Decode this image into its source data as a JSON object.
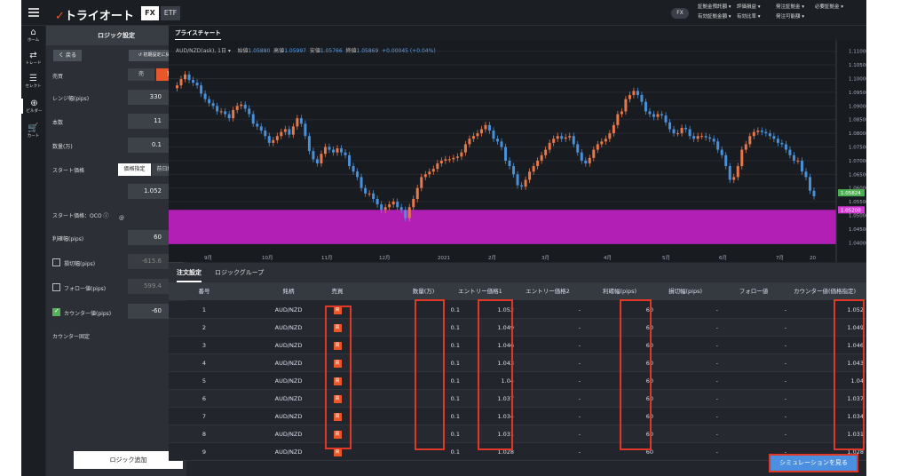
{
  "topbar": {
    "logo": "トライオート",
    "seg_fx": "FX",
    "seg_etf": "ETF",
    "fx_badge": "FX",
    "links": [
      "証拠金預託額 ▾",
      "評価損益 ▾",
      "発注証拠金 ▾",
      "必要証拠金 ▾",
      "有効証拠金額 ▾",
      "有効比率 ▾",
      "発注可能額 ▾"
    ]
  },
  "nav": [
    {
      "icon": "⌂",
      "label": "ホーム"
    },
    {
      "icon": "⇄",
      "label": "トレード"
    },
    {
      "icon": "☰",
      "label": "セレクト"
    },
    {
      "icon": "⊕",
      "label": "ビルダー"
    },
    {
      "icon": "🛒",
      "label": "カート"
    }
  ],
  "panel": {
    "title": "ロジック設定",
    "back": "く 戻る",
    "reset": "↺ 初期設定に戻る",
    "side_label": "売買",
    "sell": "売",
    "buy": "買",
    "range_label": "レンジ幅(pips)",
    "range": "330",
    "count_label": "本数",
    "count": "11",
    "qty_label": "数量(万)",
    "qty": "0.1",
    "start_label": "スタート価格",
    "start_price_btn": "価格指定",
    "prev_close_btn": "前日終値",
    "at": "@",
    "start_value": "1.052",
    "oco_label": "スタート価格：OCO ⓘ",
    "profit_label": "利確幅(pips)",
    "profit": "60",
    "loss_label": "損切幅(pips)",
    "loss": "-615.6",
    "follow_label": "フォロー値(pips)",
    "follow": "599.4",
    "counter_label": "カウンター値(pips)",
    "counter": "-60",
    "counter_fix_label": "カウンター固定",
    "add_button": "ロジック追加"
  },
  "chart_tab": "プライスチャート",
  "chart_header": {
    "symbol": "AUD/NZD(ask), 1日 ▾",
    "open_l": "始値",
    "open": "1.05880",
    "high_l": "高値",
    "high": "1.05997",
    "low_l": "安値",
    "low": "1.05766",
    "close_l": "終値",
    "close": "1.05869",
    "change": "+0.00045 (+0.04%)"
  },
  "chart_data": {
    "type": "candlestick",
    "symbol": "AUD/NZD",
    "y_ticks": [
      "1.11000",
      "1.10500",
      "1.10000",
      "1.09500",
      "1.09000",
      "1.08500",
      "1.08000",
      "1.07500",
      "1.07000",
      "1.06500",
      "1.06000",
      "1.05500",
      "1.05000",
      "1.04500",
      "1.04000"
    ],
    "ylim": [
      1.0375,
      1.1125
    ],
    "x_ticks": [
      "9月",
      "10月",
      "11月",
      "12月",
      "2021",
      "2月",
      "3月",
      "4月",
      "5月",
      "6月",
      "7月",
      "20"
    ],
    "markers": [
      {
        "value": "1.05824",
        "color": "#4caf50"
      },
      {
        "value": "1.05200",
        "color": "#d63ad6"
      }
    ],
    "zone": {
      "from": 1.052,
      "to": 1.0395,
      "color": "#b21fb5"
    },
    "closes": [
      1.0975,
      1.0998,
      1.1015,
      1.0995,
      1.0985,
      1.0975,
      1.0945,
      1.0925,
      1.091,
      1.09,
      1.088,
      1.088,
      1.087,
      1.0855,
      1.0885,
      1.09,
      1.0905,
      1.089,
      1.087,
      1.0835,
      1.0825,
      1.081,
      1.079,
      1.0765,
      1.0775,
      1.079,
      1.0805,
      1.0815,
      1.0795,
      1.0825,
      1.0855,
      1.0835,
      1.079,
      1.0735,
      1.0705,
      1.069,
      1.0725,
      1.075,
      1.074,
      1.073,
      1.0745,
      1.073,
      1.072,
      1.068,
      1.066,
      1.064,
      1.06,
      1.058,
      1.058,
      1.056,
      1.054,
      1.052,
      1.053,
      1.054,
      1.055,
      1.053,
      1.052,
      1.049,
      1.053,
      1.056,
      1.06,
      1.064,
      1.065,
      1.066,
      1.067,
      1.069,
      1.07,
      1.0705,
      1.0705,
      1.071,
      1.0715,
      1.073,
      1.076,
      1.078,
      1.079,
      1.08,
      1.0815,
      1.083,
      1.081,
      1.078,
      1.077,
      1.075,
      1.07,
      1.068,
      1.065,
      1.061,
      1.0605,
      1.063,
      1.066,
      1.068,
      1.07,
      1.072,
      1.074,
      1.0765,
      1.078,
      1.079,
      1.078,
      1.0785,
      1.079,
      1.076,
      1.073,
      1.07,
      1.069,
      1.071,
      1.074,
      1.076,
      1.077,
      1.078,
      1.08,
      1.083,
      1.087,
      1.088,
      1.0925,
      1.094,
      1.0955,
      1.094,
      1.0915,
      1.088,
      1.087,
      1.086,
      1.087,
      1.0865,
      1.084,
      1.0815,
      1.08,
      1.08,
      1.082,
      1.0815,
      1.079,
      1.078,
      1.079,
      1.079,
      1.0785,
      1.078,
      1.077,
      1.074,
      1.072,
      1.068,
      1.063,
      1.064,
      1.068,
      1.074,
      1.076,
      1.079,
      1.0805,
      1.081,
      1.0805,
      1.08,
      1.079,
      1.078,
      1.0765,
      1.076,
      1.074,
      1.072,
      1.07,
      1.07,
      1.066,
      1.064,
      1.059,
      1.057
    ]
  },
  "orders": {
    "tabs": [
      "注文設定",
      "ロジックグループ"
    ],
    "headers": [
      "番号",
      "銘柄",
      "売買",
      "数量(万)",
      "エントリー価格1",
      "エントリー価格2",
      "利確幅(pips)",
      "損切幅(pips)",
      "フォロー値",
      "カウンター値(価格指定)"
    ],
    "rows": [
      {
        "no": "1",
        "sym": "AUD/NZD",
        "side": "買",
        "qty": "0.1",
        "e1": "1.052",
        "e2": "-",
        "tp": "60",
        "sl": "-",
        "fw": "-",
        "cv": "1.052"
      },
      {
        "no": "2",
        "sym": "AUD/NZD",
        "side": "買",
        "qty": "0.1",
        "e1": "1.049",
        "e2": "-",
        "tp": "60",
        "sl": "-",
        "fw": "-",
        "cv": "1.049"
      },
      {
        "no": "3",
        "sym": "AUD/NZD",
        "side": "買",
        "qty": "0.1",
        "e1": "1.046",
        "e2": "-",
        "tp": "60",
        "sl": "-",
        "fw": "-",
        "cv": "1.046"
      },
      {
        "no": "4",
        "sym": "AUD/NZD",
        "side": "買",
        "qty": "0.1",
        "e1": "1.043",
        "e2": "-",
        "tp": "60",
        "sl": "-",
        "fw": "-",
        "cv": "1.043"
      },
      {
        "no": "5",
        "sym": "AUD/NZD",
        "side": "買",
        "qty": "0.1",
        "e1": "1.04",
        "e2": "-",
        "tp": "60",
        "sl": "-",
        "fw": "-",
        "cv": "1.04"
      },
      {
        "no": "6",
        "sym": "AUD/NZD",
        "side": "買",
        "qty": "0.1",
        "e1": "1.037",
        "e2": "-",
        "tp": "60",
        "sl": "-",
        "fw": "-",
        "cv": "1.037"
      },
      {
        "no": "7",
        "sym": "AUD/NZD",
        "side": "買",
        "qty": "0.1",
        "e1": "1.034",
        "e2": "-",
        "tp": "60",
        "sl": "-",
        "fw": "-",
        "cv": "1.034"
      },
      {
        "no": "8",
        "sym": "AUD/NZD",
        "side": "買",
        "qty": "0.1",
        "e1": "1.031",
        "e2": "-",
        "tp": "60",
        "sl": "-",
        "fw": "-",
        "cv": "1.031"
      },
      {
        "no": "9",
        "sym": "AUD/NZD",
        "side": "買",
        "qty": "0.1",
        "e1": "1.028",
        "e2": "-",
        "tp": "60",
        "sl": "-",
        "fw": "-",
        "cv": "1.028"
      }
    ]
  },
  "sim_button": "シミュレーションを見る"
}
